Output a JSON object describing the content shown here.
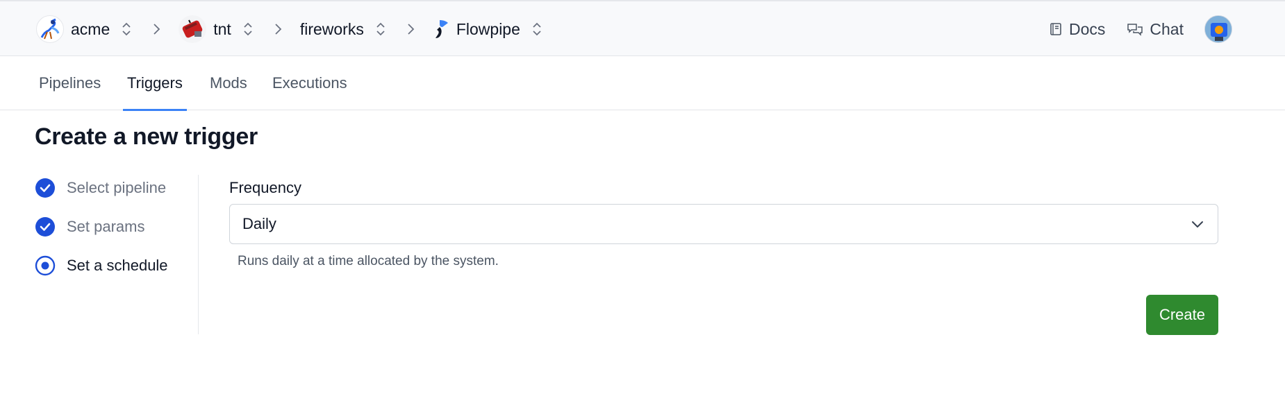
{
  "breadcrumb": {
    "items": [
      {
        "label": "acme",
        "icon": "roadrunner-avatar-icon"
      },
      {
        "label": "tnt",
        "icon": "dynamite-avatar-icon"
      },
      {
        "label": "fireworks",
        "icon": ""
      },
      {
        "label": "Flowpipe",
        "icon": "flowpipe-logo-icon"
      }
    ]
  },
  "header": {
    "docs_label": "Docs",
    "chat_label": "Chat",
    "user_avatar": "user-avatar-icon"
  },
  "tabs": [
    {
      "label": "Pipelines",
      "active": false
    },
    {
      "label": "Triggers",
      "active": true
    },
    {
      "label": "Mods",
      "active": false
    },
    {
      "label": "Executions",
      "active": false
    }
  ],
  "page": {
    "title": "Create a new trigger"
  },
  "steps": [
    {
      "label": "Select pipeline",
      "status": "complete"
    },
    {
      "label": "Set params",
      "status": "complete"
    },
    {
      "label": "Set a schedule",
      "status": "current"
    }
  ],
  "form": {
    "frequency_label": "Frequency",
    "frequency_value": "Daily",
    "frequency_help": "Runs daily at a time allocated by the system.",
    "create_label": "Create"
  },
  "colors": {
    "accent": "#3b82f6",
    "step_complete": "#1d4ed8",
    "create_button": "#2f8a2f"
  }
}
